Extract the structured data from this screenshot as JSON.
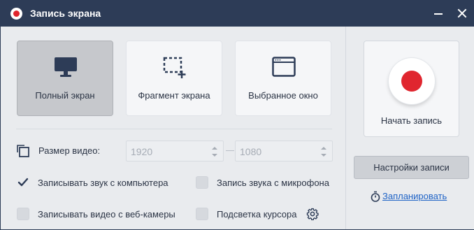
{
  "window": {
    "title": "Запись экрана",
    "icons": {
      "app": "record-icon",
      "minimize": "minimize-icon",
      "close": "close-icon"
    }
  },
  "modes": [
    {
      "label": "Полный экран",
      "icon": "monitor-icon",
      "selected": true
    },
    {
      "label": "Фрагмент экрана",
      "icon": "fragment-select-icon",
      "selected": false
    },
    {
      "label": "Выбранное окно",
      "icon": "window-icon",
      "selected": false
    }
  ],
  "video_size": {
    "label": "Размер видео:",
    "width": "1920",
    "height": "1080"
  },
  "options": {
    "system_audio": {
      "label": "Записывать звук с компьютера",
      "checked": true
    },
    "mic_audio": {
      "label": "Запись звука с микрофона",
      "checked": false
    },
    "webcam": {
      "label": "Записывать видео с веб-камеры",
      "checked": false
    },
    "cursor_highlight": {
      "label": "Подсветка курсора",
      "checked": false
    }
  },
  "record": {
    "label": "Начать запись"
  },
  "settings_button": "Настройки записи",
  "schedule_link": "Запланировать",
  "colors": {
    "titlebar": "#2d3c57",
    "accent_red": "#e0262f",
    "link_blue": "#1f63c6",
    "icon_navy": "#2d3c57"
  }
}
